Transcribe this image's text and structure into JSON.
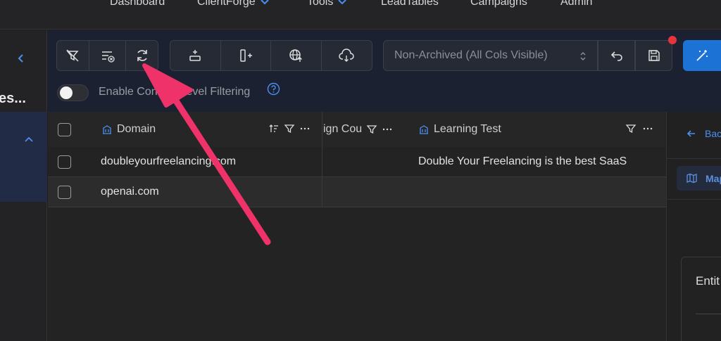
{
  "nav": {
    "items": [
      {
        "label": "Dashboard",
        "has_dropdown": false
      },
      {
        "label": "ClientForge",
        "has_dropdown": true
      },
      {
        "label": "Tools",
        "has_dropdown": true
      },
      {
        "label": "LeadTables",
        "has_dropdown": false
      },
      {
        "label": "Campaigns",
        "has_dropdown": false
      },
      {
        "label": "Admin",
        "has_dropdown": false
      }
    ]
  },
  "sidebar": {
    "truncated_label": "es..."
  },
  "toolbar": {
    "view_select": "Non-Archived (All Cols Visible)",
    "toggle_label": "Enable Content-Level Filtering",
    "toggle_on": false
  },
  "table": {
    "columns": [
      {
        "label": "Domain",
        "icon": "building-icon"
      },
      {
        "label": "ign Cou",
        "icon": ""
      },
      {
        "label": "Learning Test",
        "icon": "building-icon"
      }
    ],
    "rows": [
      {
        "domain": "doubleyourfreelancing.com",
        "learning_test": "Double Your Freelancing is the best SaaS"
      },
      {
        "domain": "openai.com",
        "learning_test": ""
      }
    ]
  },
  "right_panel": {
    "back_label": "Bac",
    "map_label": "Map",
    "entity_label": "Entit"
  },
  "colors": {
    "accent": "#1d72d6",
    "annotation_arrow": "#f0326a",
    "notification_dot": "#e5343b",
    "link": "#4b8ff0"
  }
}
